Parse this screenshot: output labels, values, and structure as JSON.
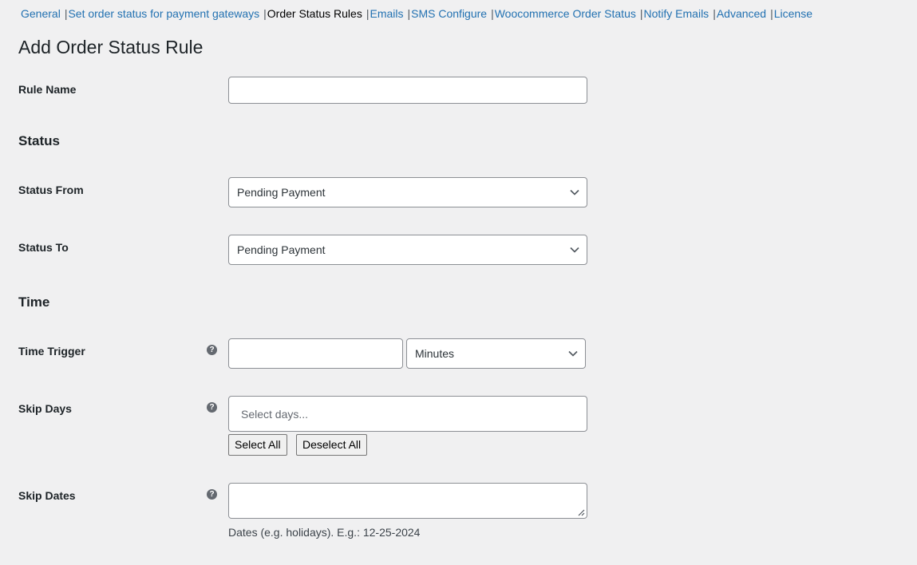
{
  "nav": {
    "items": [
      {
        "label": "General",
        "current": false
      },
      {
        "label": "Set order status for payment gateways",
        "current": false
      },
      {
        "label": "Order Status Rules",
        "current": true
      },
      {
        "label": "Emails",
        "current": false
      },
      {
        "label": "SMS Configure",
        "current": false
      },
      {
        "label": "Woocommerce Order Status",
        "current": false
      },
      {
        "label": "Notify Emails",
        "current": false
      },
      {
        "label": "Advanced",
        "current": false
      },
      {
        "label": "License",
        "current": false
      }
    ],
    "separator": "|"
  },
  "page_title": "Add Order Status Rule",
  "form": {
    "rule_name": {
      "label": "Rule Name",
      "value": ""
    },
    "status_section": "Status",
    "status_from": {
      "label": "Status From",
      "value": "Pending Payment"
    },
    "status_to": {
      "label": "Status To",
      "value": "Pending Payment"
    },
    "time_section": "Time",
    "time_trigger": {
      "label": "Time Trigger",
      "value": "",
      "unit": "Minutes",
      "help_icon": "?"
    },
    "skip_days": {
      "label": "Skip Days",
      "placeholder": "Select days...",
      "help_icon": "?",
      "select_all": "Select All",
      "deselect_all": "Deselect All"
    },
    "skip_dates": {
      "label": "Skip Dates",
      "value": "",
      "help_icon": "?",
      "description": "Dates (e.g. holidays). E.g.: 12-25-2024"
    }
  }
}
